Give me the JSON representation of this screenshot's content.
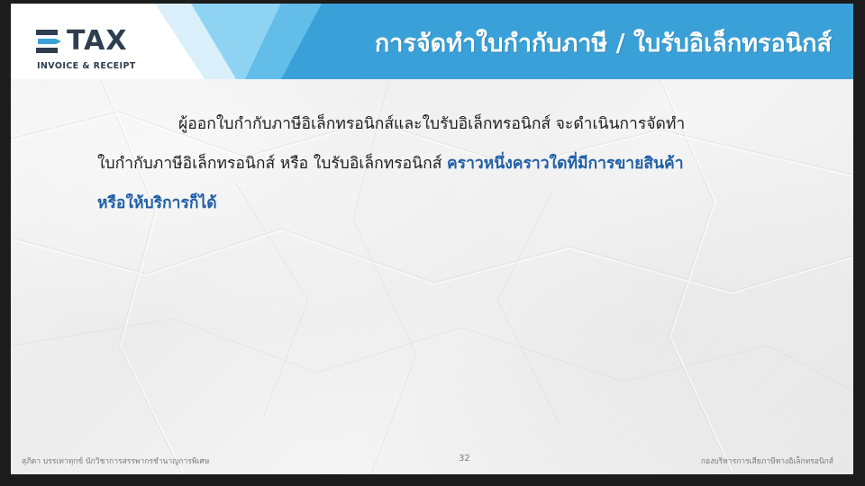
{
  "logo": {
    "brand_text": "TAX",
    "subtitle": "INVOICE & RECEIPT"
  },
  "header": {
    "title": "การจัดทำใบกำกับภาษี / ใบรับอิเล็กทรอนิกส์"
  },
  "content": {
    "line1": "ผู้ออกใบกำกับภาษีอิเล็กทรอนิกส์และใบรับอิเล็กทรอนิกส์ จะดำเนินการจัดทำ",
    "line2_plain": "ใบกำกับภาษีอิเล็กทรอนิกส์ หรือ ใบรับอิเล็กทรอนิกส์ ",
    "line2_highlight": "คราวหนึ่งคราวใดที่มีการขายสินค้า",
    "line3_highlight": "หรือให้บริการก็ได้"
  },
  "footer": {
    "presenter": "สุภิดา บรรเทาทุกข์   นักวิชาการสรรพากรชำนาญการพิเศษ",
    "page_number": "32",
    "department": "กองบริหารการเสียภาษีทางอิเล็กทรอนิกส์"
  },
  "colors": {
    "header_blue": "#3aa0d8",
    "header_light_blue": "#8fd3f3",
    "highlight_text": "#1f5fa8",
    "logo_accent": "#3aa0d8",
    "logo_dark": "#2e3d4f"
  }
}
